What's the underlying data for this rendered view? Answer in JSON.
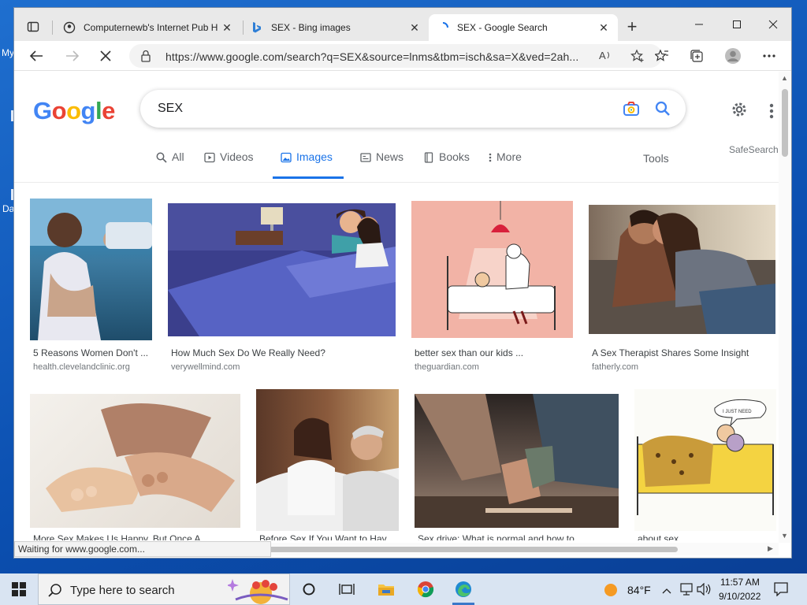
{
  "desktop": {
    "labels": [
      "My",
      "Da"
    ]
  },
  "browser": {
    "tabs": [
      {
        "title": "Computernewb's Internet Pub H",
        "icon": "pub-favicon-icon",
        "active": false
      },
      {
        "title": "SEX - Bing images",
        "icon": "bing-favicon-icon",
        "active": false
      },
      {
        "title": "SEX - Google Search",
        "icon": "loading-spinner-icon",
        "active": true
      }
    ],
    "tab_close": "✕",
    "new_tab": "+",
    "url": "https://www.google.com/search?q=SEX&source=lnms&tbm=isch&sa=X&ved=2ah...",
    "status": "Waiting for www.google.com..."
  },
  "google": {
    "logo_letters": [
      {
        "ch": "G",
        "color": "#4285F4"
      },
      {
        "ch": "o",
        "color": "#EA4335"
      },
      {
        "ch": "o",
        "color": "#FBBC05"
      },
      {
        "ch": "g",
        "color": "#4285F4"
      },
      {
        "ch": "l",
        "color": "#34A853"
      },
      {
        "ch": "e",
        "color": "#EA4335"
      }
    ],
    "query": "SEX",
    "safesearch": "SafeSearch",
    "tools": "Tools",
    "nav": [
      {
        "label": "All",
        "icon": "search-icon",
        "active": false
      },
      {
        "label": "Videos",
        "icon": "video-icon",
        "active": false
      },
      {
        "label": "Images",
        "icon": "image-icon",
        "active": true
      },
      {
        "label": "News",
        "icon": "news-icon",
        "active": false
      },
      {
        "label": "Books",
        "icon": "book-icon",
        "active": false
      },
      {
        "label": "More",
        "icon": "more-vert-icon",
        "active": false
      }
    ],
    "results": [
      {
        "title": "5 Reasons Women Don't ...",
        "source": "health.clevelandclinic.org"
      },
      {
        "title": "How Much Sex Do We Really Need?",
        "source": "verywellmind.com"
      },
      {
        "title": "better sex than our kids ...",
        "source": "theguardian.com"
      },
      {
        "title": "A Sex Therapist Shares Some Insight",
        "source": "fatherly.com"
      },
      {
        "title": "More Sex Makes Us Happy, But Once A ...",
        "source": ""
      },
      {
        "title": "Before Sex If You Want to Hav...",
        "source": ""
      },
      {
        "title": "Sex drive: What is normal and how to ...",
        "source": ""
      },
      {
        "title": "about sex ...",
        "source": ""
      }
    ]
  },
  "taskbar": {
    "search_placeholder": "Type here to search",
    "temperature": "84°F",
    "time": "11:57 AM",
    "date": "9/10/2022"
  }
}
